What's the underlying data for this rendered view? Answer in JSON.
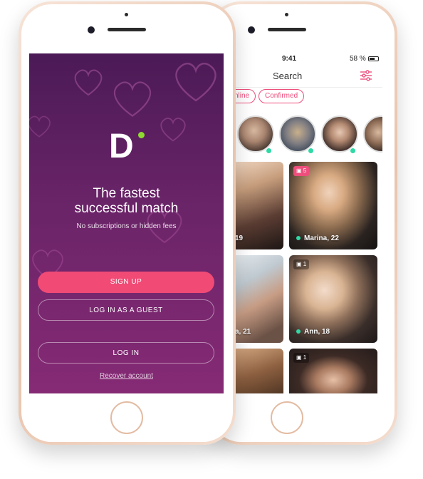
{
  "login_screen": {
    "logo_letter": "D",
    "headline_line1": "The fastest",
    "headline_line2": "successful match",
    "subtitle": "No subscriptions or hidden fees",
    "sign_up_label": "SIGN UP",
    "guest_label": "LOG IN AS A GUEST",
    "login_label": "LOG IN",
    "recover_label": "Recover account",
    "colors": {
      "primary": "#f04a75",
      "bg_top": "#4b1a56",
      "bg_bottom": "#862a75",
      "logo_dot": "#8edb2f"
    }
  },
  "search_screen": {
    "status": {
      "time": "9:41",
      "battery": "58 %"
    },
    "title": "Search",
    "filters": [
      "nline",
      "Confirmed"
    ],
    "stories": [
      {
        "icon": "avatar",
        "online": true
      },
      {
        "icon": "avatar",
        "online": true
      },
      {
        "icon": "avatar",
        "online": true
      },
      {
        "icon": "avatar",
        "online": false
      }
    ],
    "cards": [
      {
        "name": "19",
        "online": false,
        "photo_count": ""
      },
      {
        "name": "Marina, 22",
        "online": true,
        "photo_count": "5"
      },
      {
        "name": "a, 21",
        "online": false,
        "photo_count": ""
      },
      {
        "name": "Ann, 18",
        "online": true,
        "photo_count": "1"
      },
      {
        "name": "",
        "online": false,
        "photo_count": ""
      },
      {
        "name": "",
        "online": false,
        "photo_count": "1"
      }
    ],
    "colors": {
      "accent": "#ee4e7c",
      "online": "#2fd9a6"
    }
  }
}
